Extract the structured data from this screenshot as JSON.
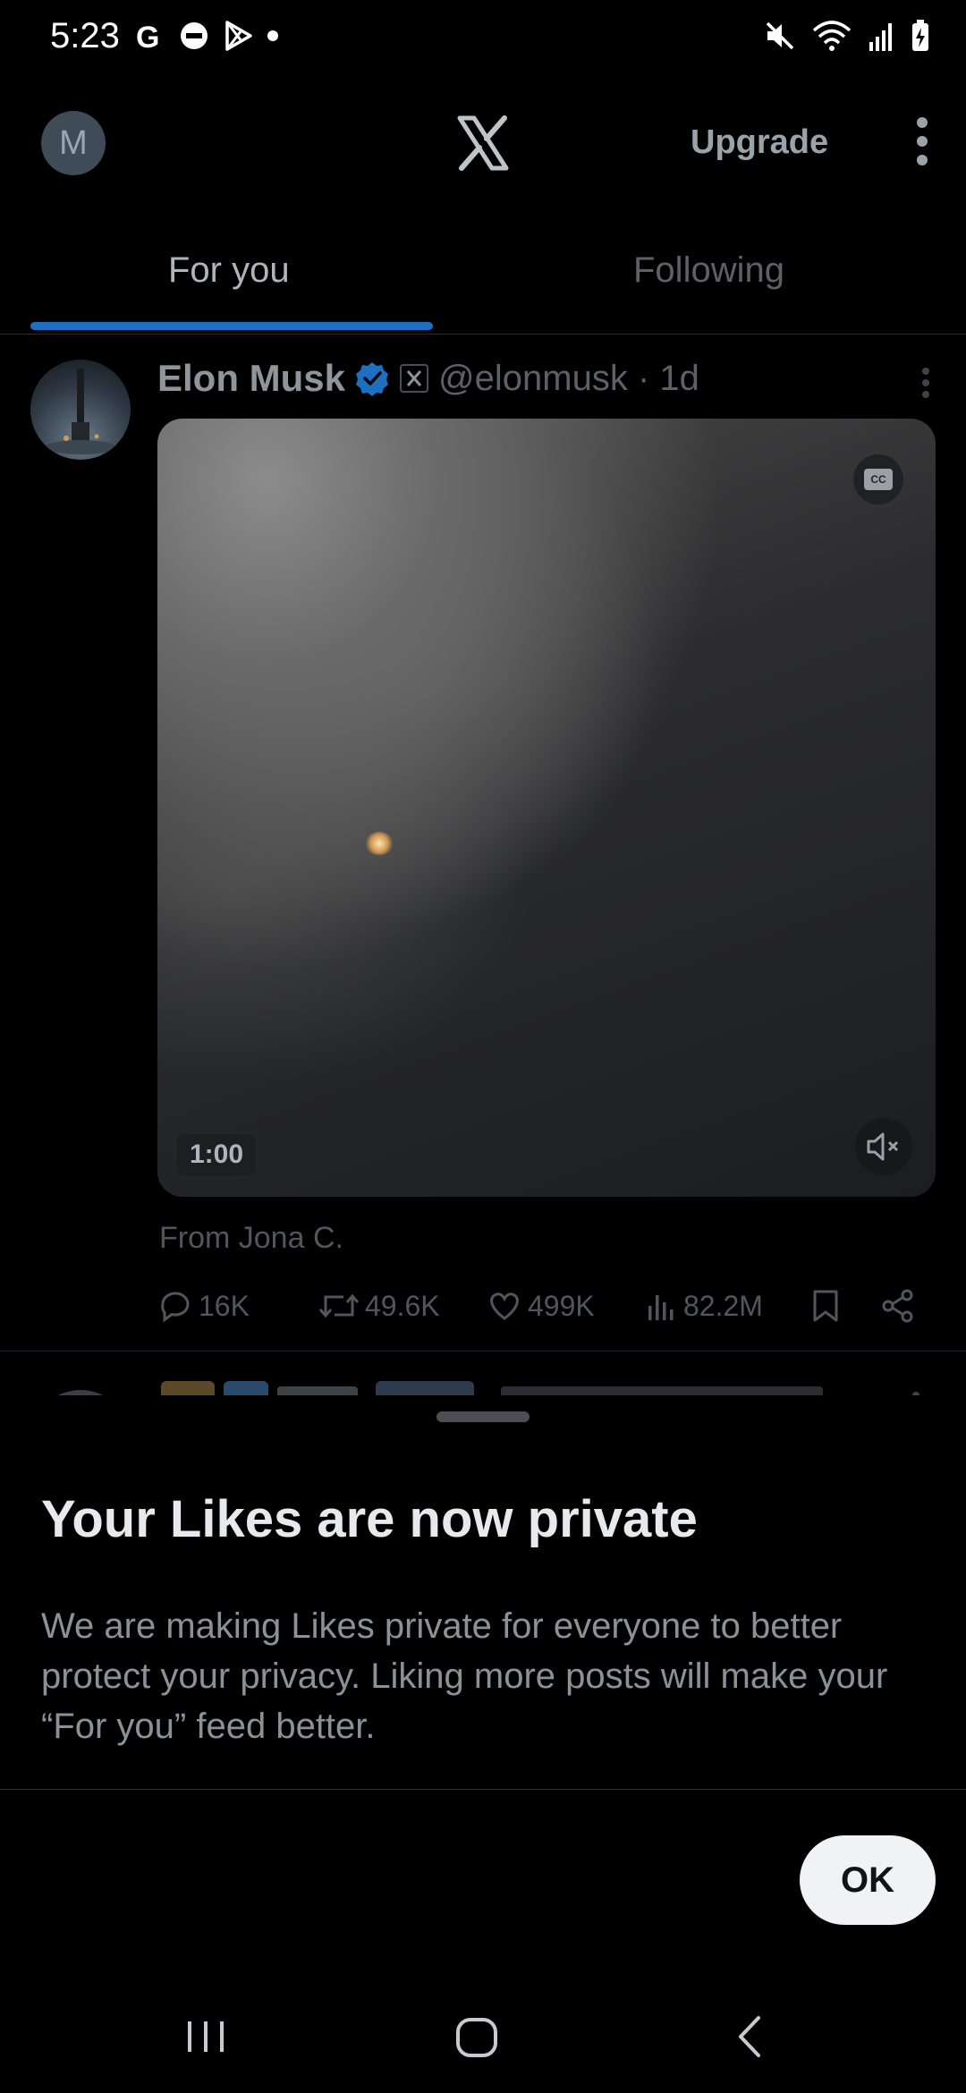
{
  "status_bar": {
    "time": "5:23"
  },
  "header": {
    "avatar_initial": "M",
    "upgrade_label": "Upgrade"
  },
  "tabs": [
    {
      "label": "For you",
      "active": true
    },
    {
      "label": "Following",
      "active": false
    }
  ],
  "post": {
    "author_name": "Elon Musk",
    "handle_time": "@elonmusk · 1d",
    "video_duration": "1:00",
    "cc_label": "CC",
    "source_text": "From Jona C.",
    "stats": {
      "replies": "16K",
      "reposts": "49.6K",
      "likes": "499K",
      "views": "82.2M"
    }
  },
  "sheet": {
    "title": "Your Likes are now private",
    "body": "We are making Likes private for everyone to better protect your privacy. Liking more posts will make your “For you” feed better.",
    "ok_label": "OK"
  },
  "colors": {
    "accent": "#1d6fbf",
    "verified": "#1d9bf0"
  }
}
